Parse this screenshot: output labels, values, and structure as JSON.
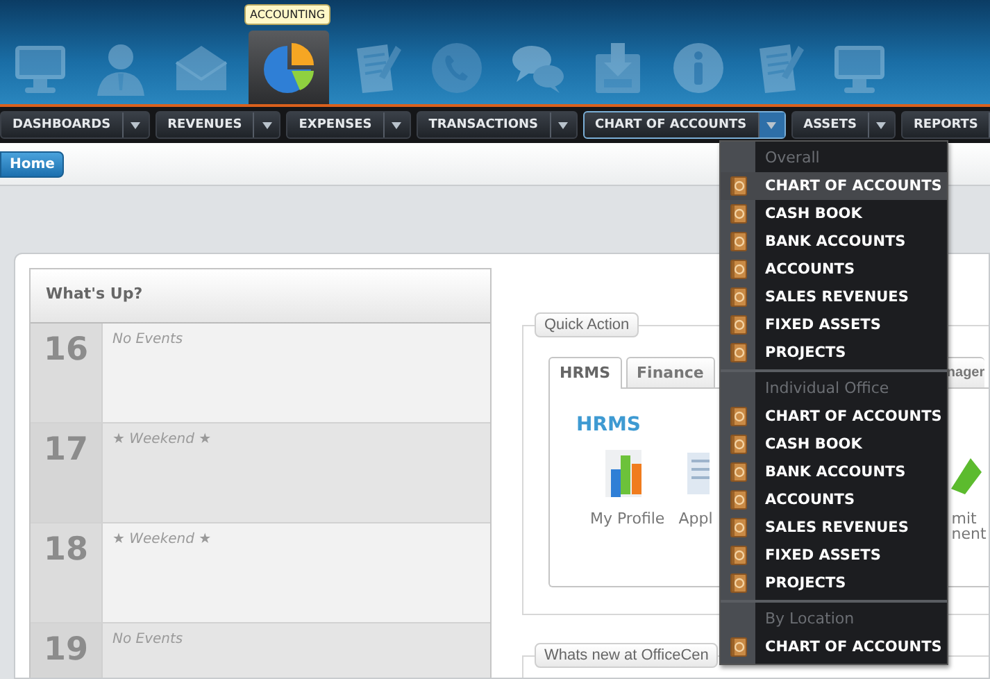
{
  "banner": {
    "modules": [
      {
        "kind": "monitor",
        "selected": false
      },
      {
        "kind": "person",
        "selected": false
      },
      {
        "kind": "envelope",
        "selected": false
      },
      {
        "kind": "pie",
        "selected": true,
        "tooltip": "ACCOUNTING"
      },
      {
        "kind": "document",
        "selected": false
      },
      {
        "kind": "phone",
        "selected": false
      },
      {
        "kind": "chat",
        "selected": false
      },
      {
        "kind": "inbox",
        "selected": false
      },
      {
        "kind": "info",
        "selected": false
      },
      {
        "kind": "document",
        "selected": false
      },
      {
        "kind": "monitor",
        "selected": false
      }
    ]
  },
  "nav": {
    "items": [
      {
        "label": "DASHBOARDS",
        "selected": false
      },
      {
        "label": "REVENUES",
        "selected": false
      },
      {
        "label": "EXPENSES",
        "selected": false
      },
      {
        "label": "TRANSACTIONS",
        "selected": false
      },
      {
        "label": "CHART OF ACCOUNTS",
        "selected": true
      },
      {
        "label": "ASSETS",
        "selected": false
      },
      {
        "label": "REPORTS",
        "selected": false
      }
    ]
  },
  "breadcrumb": {
    "home": "Home"
  },
  "whats_up": {
    "title": "What's Up?",
    "days": [
      {
        "day": "16",
        "text": "No Events"
      },
      {
        "day": "17",
        "text": "★ Weekend ★"
      },
      {
        "day": "18",
        "text": "★ Weekend ★"
      },
      {
        "day": "19",
        "text": "No Events"
      }
    ]
  },
  "quick_action": {
    "legend": "Quick Action",
    "tabs": [
      {
        "label": "HRMS",
        "selected": true
      },
      {
        "label": "Finance",
        "selected": false
      },
      {
        "label": "nager",
        "selected": false
      }
    ],
    "heading": "HRMS",
    "items": [
      {
        "kind": "chart",
        "lines": [
          "My Profile"
        ]
      },
      {
        "kind": "document",
        "lines": [
          "Appl"
        ]
      },
      {
        "kind": "check",
        "lines": [
          "mit",
          "nent"
        ]
      }
    ]
  },
  "whats_new": {
    "legend": "Whats new at OfficeCen"
  },
  "menu": {
    "sections": [
      {
        "heading": "Overall",
        "items": [
          {
            "label": "CHART OF ACCOUNTS",
            "selected": true
          },
          {
            "label": "CASH BOOK",
            "selected": false
          },
          {
            "label": "BANK ACCOUNTS",
            "selected": false
          },
          {
            "label": "ACCOUNTS",
            "selected": false
          },
          {
            "label": "SALES REVENUES",
            "selected": false
          },
          {
            "label": "FIXED ASSETS",
            "selected": false
          },
          {
            "label": "PROJECTS",
            "selected": false
          }
        ]
      },
      {
        "heading": "Individual Office",
        "items": [
          {
            "label": "CHART OF ACCOUNTS",
            "selected": false
          },
          {
            "label": "CASH BOOK",
            "selected": false
          },
          {
            "label": "BANK ACCOUNTS",
            "selected": false
          },
          {
            "label": "ACCOUNTS",
            "selected": false
          },
          {
            "label": "SALES REVENUES",
            "selected": false
          },
          {
            "label": "FIXED ASSETS",
            "selected": false
          },
          {
            "label": "PROJECTS",
            "selected": false
          }
        ]
      },
      {
        "heading": "By Location",
        "items": [
          {
            "label": "CHART OF ACCOUNTS",
            "selected": false
          }
        ]
      }
    ]
  }
}
